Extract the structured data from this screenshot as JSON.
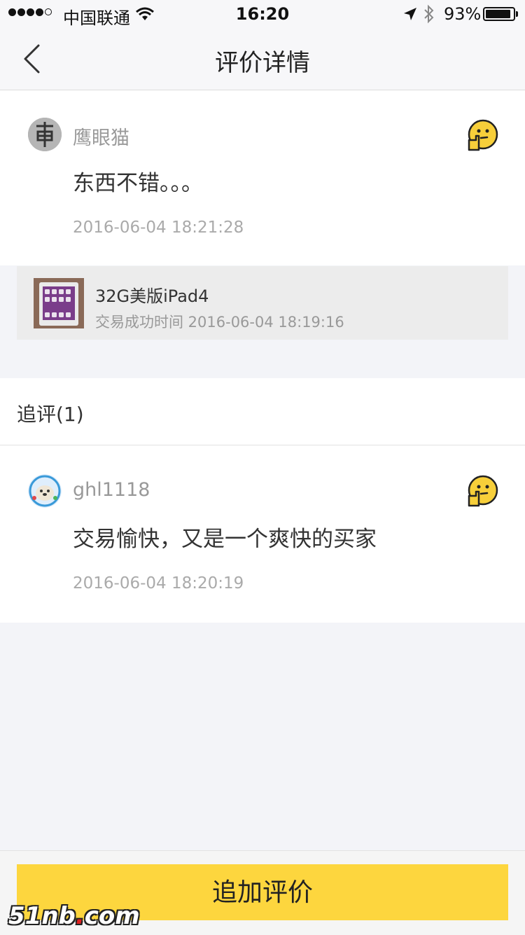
{
  "status_bar": {
    "carrier": "中国联通",
    "time": "16:20",
    "battery": "93%",
    "battery_level": 0.93
  },
  "nav": {
    "title": "评价详情"
  },
  "review": {
    "username": "鹰眼猫",
    "content": "东西不错。。。",
    "time": "2016-06-04 18:21:28"
  },
  "product": {
    "title": "32G美版iPad4",
    "subtitle": "交易成功时间 2016-06-04 18:19:16"
  },
  "followup": {
    "section_title": "追评(1)",
    "username": "ghl1118",
    "content": "交易愉快，又是一个爽快的买家",
    "time": "2016-06-04 18:20:19"
  },
  "footer": {
    "button_label": "追加评价"
  },
  "watermark": {
    "text_main": "51nb",
    "text_dot": ".",
    "text_tail": "com"
  },
  "colors": {
    "accent": "#fdd63e",
    "emoji": "#f7cf3a"
  },
  "icons": {
    "back": "chevron-left-icon",
    "emoji": "thinking-face-icon",
    "wifi": "wifi-icon",
    "location": "location-arrow-icon",
    "bluetooth": "bluetooth-icon"
  }
}
